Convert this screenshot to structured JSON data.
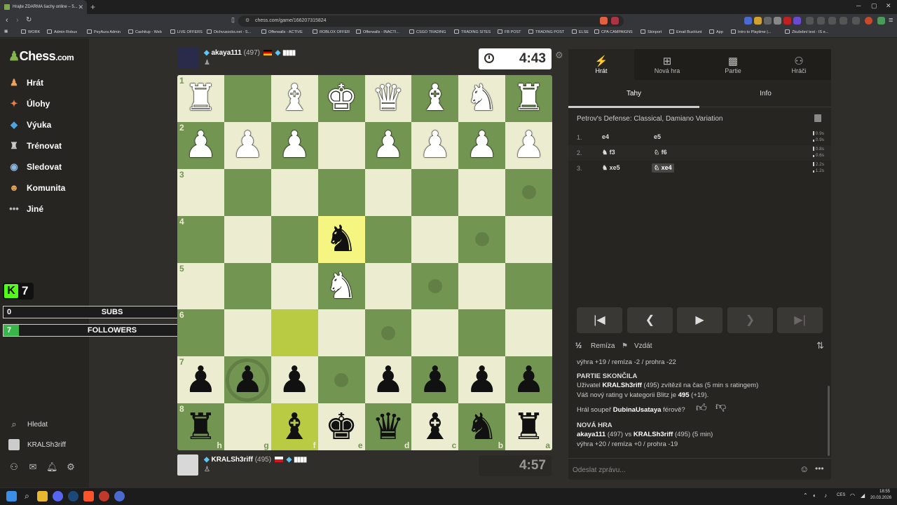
{
  "browser": {
    "tab_title": "Hrajte ZDARMA šachy online – 5...",
    "url": "chess.com/game/166207315824",
    "bookmarks": [
      "WORK",
      "Admin Robux",
      "PeyAura Admin",
      "Cashitup - Web",
      "LIVE OFFERS",
      "Dichvusocks.net - S...",
      "Offerwalls - ACTIVE",
      "ROBLOX OFFER",
      "Offerwalls - INACTI...",
      "CSGO TRADING",
      "TRADING SITES",
      "FB POST",
      "TRADING POST",
      "ELSE",
      "CPA CAMPAIGNS",
      "Skinport",
      "Email BuxHunt",
      "App",
      "Intro to Playtime |...",
      "Zkušební test - IS e..."
    ]
  },
  "site": {
    "logo": "Chess",
    "logo_suffix": ".com",
    "nav": [
      {
        "label": "Hrát",
        "icon": "play-icon",
        "color": "#e9a15c"
      },
      {
        "label": "Úlohy",
        "icon": "puzzle-icon",
        "color": "#f07d44"
      },
      {
        "label": "Výuka",
        "icon": "learn-icon",
        "color": "#4ca3e0"
      },
      {
        "label": "Trénovat",
        "icon": "train-icon",
        "color": "#c9c9c9"
      },
      {
        "label": "Sledovat",
        "icon": "watch-icon",
        "color": "#8fb8de"
      },
      {
        "label": "Komunita",
        "icon": "community-icon",
        "color": "#e8a55a"
      },
      {
        "label": "Jiné",
        "icon": "more-icon",
        "color": "#bbbbbb"
      }
    ],
    "search_label": "Hledat",
    "profile_label": "KRALSh3riff"
  },
  "overlay": {
    "kick_count": "7",
    "subs": {
      "current": "0",
      "label": "SUBS",
      "goal": "10",
      "progress": 0.0
    },
    "followers": {
      "current": "7",
      "label": "FOLLOWERS",
      "goal": "100",
      "progress": 0.07
    }
  },
  "game": {
    "opponent": {
      "name": "akaya111",
      "rating": "(497)",
      "clock": "4:43"
    },
    "me": {
      "name": "KRALSh3riff",
      "rating": "(495)",
      "clock": "4:57"
    },
    "ranks": [
      "1",
      "2",
      "3",
      "4",
      "5",
      "6",
      "7",
      "8"
    ],
    "files": [
      "h",
      "g",
      "f",
      "e",
      "d",
      "c",
      "b",
      "a"
    ],
    "board": [
      [
        "wR",
        "",
        "wB",
        "wK",
        "wQ",
        "wB",
        "wN",
        "wR"
      ],
      [
        "wP",
        "wP",
        "wP",
        "",
        "wP",
        "wP",
        "wP",
        "wP"
      ],
      [
        "",
        "",
        "",
        "",
        "",
        "",
        "",
        ""
      ],
      [
        "",
        "",
        "",
        "bN",
        "",
        "",
        "",
        ""
      ],
      [
        "",
        "",
        "",
        "wN",
        "",
        "",
        "",
        ""
      ],
      [
        "",
        "",
        "",
        "",
        "",
        "",
        "",
        ""
      ],
      [
        "bP",
        "bP",
        "bP",
        "",
        "bP",
        "bP",
        "bP",
        "bP"
      ],
      [
        "bR",
        "",
        "bB",
        "bK",
        "bQ",
        "bB",
        "bN",
        "bR"
      ]
    ],
    "highlights": [
      [
        3,
        3
      ],
      [
        5,
        2
      ],
      [
        7,
        2
      ]
    ],
    "hints": [
      [
        2,
        7
      ],
      [
        3,
        6
      ],
      [
        4,
        5
      ],
      [
        5,
        4
      ],
      [
        6,
        3
      ]
    ],
    "hint_ring": [
      [
        6,
        1
      ]
    ]
  },
  "panel": {
    "tabs": [
      {
        "label": "Hrát",
        "icon": "lightning-icon"
      },
      {
        "label": "Nová hra",
        "icon": "plus-icon"
      },
      {
        "label": "Partie",
        "icon": "board-icon"
      },
      {
        "label": "Hráči",
        "icon": "players-icon"
      }
    ],
    "subtabs": [
      "Tahy",
      "Info"
    ],
    "opening": "Petrov's Defense: Classical, Damiano Variation",
    "moves": [
      {
        "num": "1.",
        "white": "e4",
        "black": "e5",
        "wt": "0.9s",
        "bt": "0.9s"
      },
      {
        "num": "2.",
        "white": "♞ f3",
        "black": "♘ f6",
        "wt": "0.8s",
        "bt": "0.6s"
      },
      {
        "num": "3.",
        "white": "♞ xe5",
        "black": "♘ xe4",
        "wt": "2.2s",
        "bt": "1.2s"
      }
    ],
    "draw_label": "Remíza",
    "draw_icon": "½",
    "resign_label": "Vzdát",
    "chat": {
      "line0": "výhra +19 / remíza -2 / prohra -22",
      "over_title": "PARTIE SKONČILA",
      "over_p1": "Uživatel ",
      "over_name": "KRALSh3riff",
      "over_p2": " (495) zvítězil na čas (5 min s ratingem)",
      "rating_p1": "Váš nový rating v kategorii Blitz je ",
      "rating_val": "495",
      "rating_p2": " (+19).",
      "fair_p1": "Hrál soupeř ",
      "fair_name": "DubinaUsataya",
      "fair_p2": " férově?",
      "new_title": "NOVÁ HRA",
      "new_a": "akaya111",
      "new_mid": " (497) vs ",
      "new_b": "KRALSh3riff",
      "new_end": " (495) (5 min)",
      "new_stakes": "výhra +20 / remíza +0 / prohra -19"
    },
    "msg_placeholder": "Odeslat zprávu..."
  },
  "taskbar": {
    "lang": "CES",
    "time": "18:55",
    "date": "20.03.2026"
  }
}
